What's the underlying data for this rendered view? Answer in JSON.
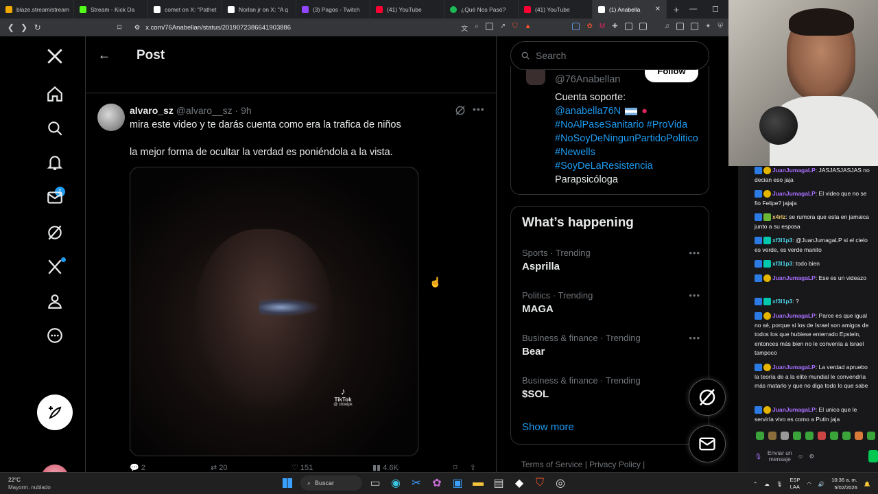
{
  "browser": {
    "tabs": [
      {
        "label": "blaze.stream/stream",
        "color": "#f2a900"
      },
      {
        "label": "Stream - Kick Da",
        "color": "#53fc18"
      },
      {
        "label": "comet on X: \"Pathet",
        "color": "#ffffff"
      },
      {
        "label": "Norlan jr on X: \"A q",
        "color": "#ffffff"
      },
      {
        "label": "(3) Pagos - Twitch",
        "color": "#9146ff"
      },
      {
        "label": "(41) YouTube",
        "color": "#ff0033"
      },
      {
        "label": "¿Qué Nos Pasó?",
        "color": "#1db954"
      },
      {
        "label": "(41) YouTube",
        "color": "#ff0033"
      },
      {
        "label": "(1) Anabella",
        "color": "#ffffff"
      }
    ],
    "new_tab": "+",
    "url": "x.com/76Anabellan/status/2019072386641903886"
  },
  "nav": {
    "items": [
      "home",
      "explore",
      "notifications",
      "messages",
      "grok",
      "premium",
      "profile",
      "more"
    ],
    "notification_count": "1"
  },
  "post": {
    "header_title": "Post",
    "reply": {
      "name": "alvaro_sz",
      "handle": "@alvaro__sz",
      "time": "· 9h",
      "text1": "mira este video y te darás cuenta como era la trafica  de niños",
      "text2": "la mejor forma de ocultar la verdad es poniéndola a la vista.",
      "tiktok_label": "TikTok",
      "tiktok_user": "@ chiwipk",
      "actions": {
        "replies": "2",
        "reposts": "20",
        "likes": "151",
        "views": "4.6K"
      }
    }
  },
  "sidebar": {
    "search_placeholder": "Search",
    "profile": {
      "handle": "@76Anabellan",
      "follow_label": "Follow",
      "bio_line1": "Cuenta soporte:",
      "bio_mention": "@anabella76N",
      "bio_tags1": "#NoAlPaseSanitario #ProVida",
      "bio_tags2": "#NoSoyDeNingunPartidoPolitico #Newells",
      "bio_tags3": "#SoyDeLaResistencia",
      "bio_last": "Parapsicóloga"
    },
    "trends_title": "What’s happening",
    "trends": [
      {
        "category": "Sports · Trending",
        "name": "Asprilla"
      },
      {
        "category": "Politics · Trending",
        "name": "MAGA"
      },
      {
        "category": "Business & finance · Trending",
        "name": "Bear"
      },
      {
        "category": "Business & finance · Trending",
        "name": "$SOL"
      }
    ],
    "show_more": "Show more",
    "footer": "Terms of Service  |  Privacy Policy  |"
  },
  "chat": {
    "messages": [
      {
        "user": "JuanJumagaLP",
        "text": ": JASJASJASJAS no decian eso jaja"
      },
      {
        "user": "JuanJumagaLP",
        "text": ": El video que no se fio Felipe? jajaja"
      },
      {
        "user": "x4rlz",
        "text": ": se rumora que esta en jamaica junto a su esposa"
      },
      {
        "user": "xf3l1p3",
        "text": ": @JuanJumagaLP si el cielo es verde, es verde manito"
      },
      {
        "user": "xf3l1p3",
        "text": ": todo bien"
      },
      {
        "user": "JuanJumagaLP",
        "text": ": Ese es un videazo"
      },
      {
        "user": "xf3l1p3",
        "text": ": ?"
      },
      {
        "user": "JuanJumagaLP",
        "text": ": Parce es que igual no sé, porque si los de Israel son amigos de todos los que hubiese enterrado Epstein, entonces más bien no le convenía a Israel tampoco"
      },
      {
        "user": "JuanJumagaLP",
        "text": ": La verdad apruebo la teoría de a la elite mundial le convendría más matarlo y que no diga todo lo que sabe"
      },
      {
        "user": "JuanJumagaLP",
        "text": ": El unico que le serviría vivo es como a Putin jaja"
      }
    ],
    "input_placeholder": "Enviar un mensaje"
  },
  "taskbar": {
    "weather_temp": "22°C",
    "weather_desc": "Mayorm. nublado",
    "search_label": "Buscar",
    "lang1": "ESP",
    "lang2": "LAA",
    "time": "10:36 a. m.",
    "date": "5/02/2026"
  }
}
